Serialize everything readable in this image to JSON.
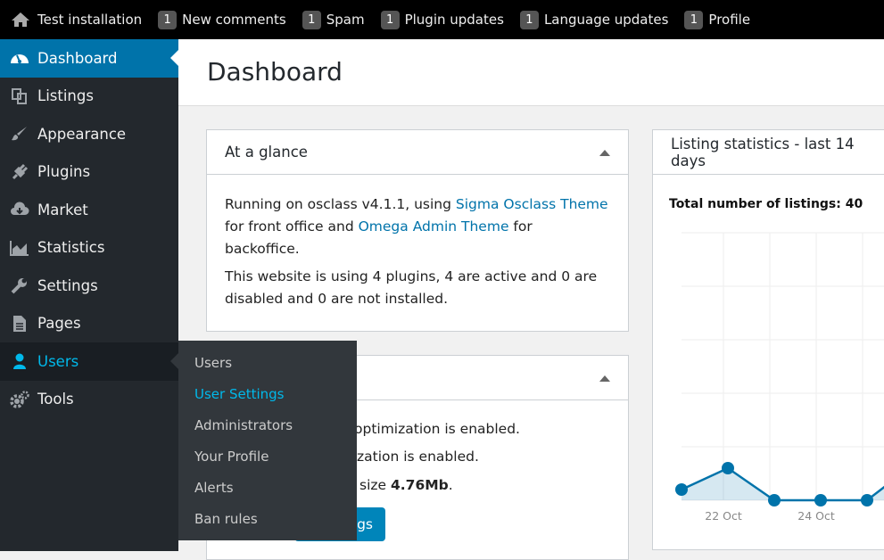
{
  "topbar": {
    "site": "Test installation",
    "items": [
      {
        "count": "1",
        "label": "New comments"
      },
      {
        "count": "1",
        "label": "Spam"
      },
      {
        "count": "1",
        "label": "Plugin updates"
      },
      {
        "count": "1",
        "label": "Language updates"
      },
      {
        "count": "1",
        "label": "Profile"
      }
    ]
  },
  "sidebar": {
    "items": [
      {
        "label": "Dashboard",
        "icon": "dashboard-icon"
      },
      {
        "label": "Listings",
        "icon": "listings-icon"
      },
      {
        "label": "Appearance",
        "icon": "brush-icon"
      },
      {
        "label": "Plugins",
        "icon": "plug-icon"
      },
      {
        "label": "Market",
        "icon": "cloud-download-icon"
      },
      {
        "label": "Statistics",
        "icon": "chart-icon"
      },
      {
        "label": "Settings",
        "icon": "wrench-icon"
      },
      {
        "label": "Pages",
        "icon": "page-icon"
      },
      {
        "label": "Users",
        "icon": "user-icon"
      },
      {
        "label": "Tools",
        "icon": "gears-icon"
      }
    ],
    "active": "Dashboard",
    "hovered": "Users"
  },
  "submenu": {
    "items": [
      "Users",
      "User Settings",
      "Administrators",
      "Your Profile",
      "Alerts",
      "Ban rules"
    ],
    "current": "User Settings"
  },
  "page": {
    "title": "Dashboard"
  },
  "glance": {
    "title": "At a glance",
    "t1": "Running on osclass v4.1.1, using ",
    "link1": "Sigma Osclass Theme",
    "t2": " for front office and ",
    "link2": "Omega Admin Theme",
    "t3": " for backoffice.",
    "p2": "This website is using 4 plugins, 4 are active and 0 are disabled and 0 are not installed."
  },
  "optim": {
    "line1": "optimization is enabled.",
    "line2": "zation is enabled.",
    "line3_pre": "size ",
    "line3_bold": "4.76Mb",
    "line3_post": ".",
    "button_fragment": "ngs"
  },
  "stats": {
    "title": "Listing statistics - last 14 days",
    "total": "Total number of listings: 40"
  },
  "colors": {
    "accent": "#0073aa",
    "sidebar": "#23282d",
    "submenu": "#32373c",
    "highlight": "#00b9eb",
    "series": "#0073aa"
  },
  "chart_data": {
    "type": "area",
    "x": [
      "21 Oct",
      "22 Oct",
      "23 Oct",
      "24 Oct",
      "25 Oct"
    ],
    "values": [
      1,
      3,
      0,
      0,
      0
    ],
    "tick_labels": [
      "22 Oct",
      "24 Oct"
    ],
    "grid": true
  }
}
